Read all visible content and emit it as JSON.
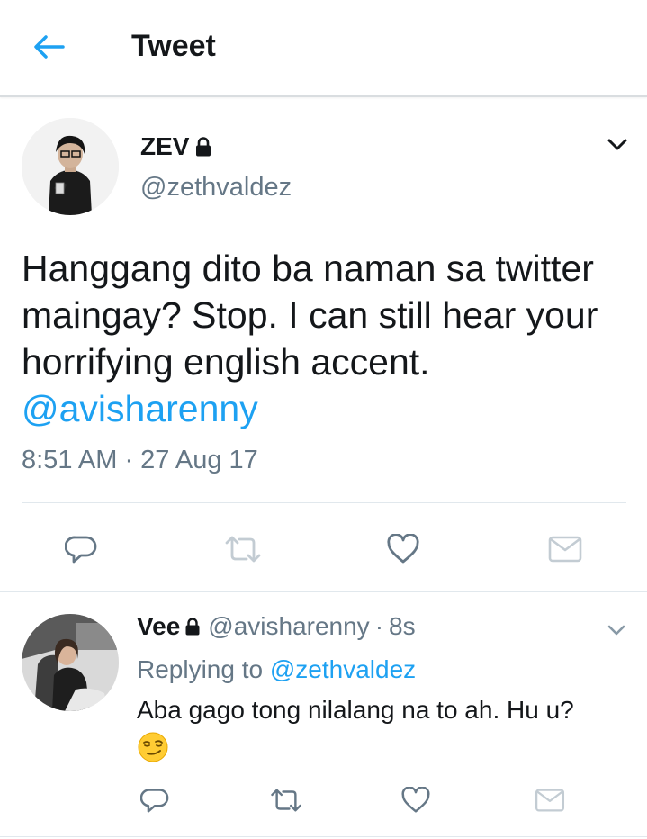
{
  "header": {
    "title": "Tweet",
    "back_icon": "arrow-left-icon"
  },
  "colors": {
    "accent": "#1da1f2",
    "text": "#14171a",
    "secondary": "#657786",
    "icon_gray": "#657786",
    "divider": "#e1e8ed"
  },
  "main_tweet": {
    "name": "ZEV",
    "handle": "@zethvaldez",
    "text_before_mention": "Hanggang dito ba naman sa twitter maingay? Stop. I can still hear your horrifying english accent. ",
    "mention": "@avisharenny",
    "timestamp": "8:51 AM · 27 Aug 17",
    "actions": [
      "reply-icon",
      "retweet-icon",
      "like-icon",
      "direct-message-icon"
    ]
  },
  "reply_tweet": {
    "name": "Vee",
    "handle": "@avisharenny",
    "separator": "·",
    "time": "8s",
    "replying_prefix": "Replying to ",
    "replying_to": "@zethvaldez",
    "text": "Aba gago tong nilalang na to ah. Hu u?",
    "emoji": "smirking-face-emoji",
    "actions": [
      "reply-icon",
      "retweet-icon",
      "like-icon",
      "direct-message-icon"
    ]
  }
}
